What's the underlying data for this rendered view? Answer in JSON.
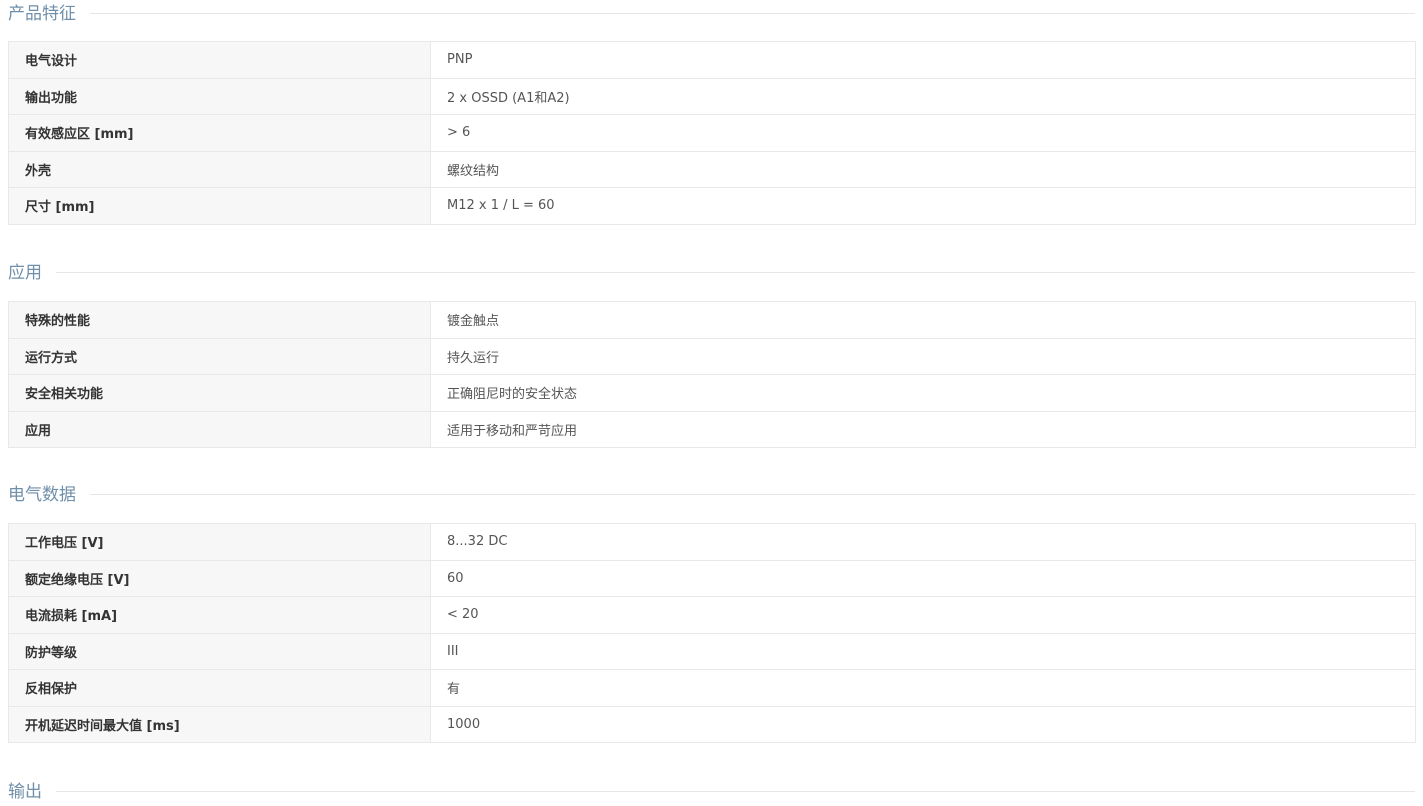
{
  "sections": [
    {
      "title": "产品特征",
      "rows": [
        {
          "label": "电气设计",
          "value": "PNP"
        },
        {
          "label": "输出功能",
          "value": "2 x OSSD (A1和A2)"
        },
        {
          "label": "有效感应区 [mm]",
          "value": "> 6"
        },
        {
          "label": "外壳",
          "value": "螺纹结构"
        },
        {
          "label": "尺寸 [mm]",
          "value": "M12 x 1 / L = 60"
        }
      ]
    },
    {
      "title": "应用",
      "rows": [
        {
          "label": "特殊的性能",
          "value": "镀金触点"
        },
        {
          "label": "运行方式",
          "value": "持久运行"
        },
        {
          "label": "安全相关功能",
          "value": "正确阻尼时的安全状态"
        },
        {
          "label": "应用",
          "value": "适用于移动和严苛应用"
        }
      ]
    },
    {
      "title": "电气数据",
      "rows": [
        {
          "label": "工作电压 [V]",
          "value": "8...32 DC"
        },
        {
          "label": "额定绝缘电压 [V]",
          "value": "60"
        },
        {
          "label": "电流损耗 [mA]",
          "value": "< 20"
        },
        {
          "label": "防护等级",
          "value": "III"
        },
        {
          "label": "反相保护",
          "value": "有"
        },
        {
          "label": "开机延迟时间最大值 [ms]",
          "value": "1000"
        }
      ]
    },
    {
      "title": "输出",
      "rows": []
    }
  ]
}
